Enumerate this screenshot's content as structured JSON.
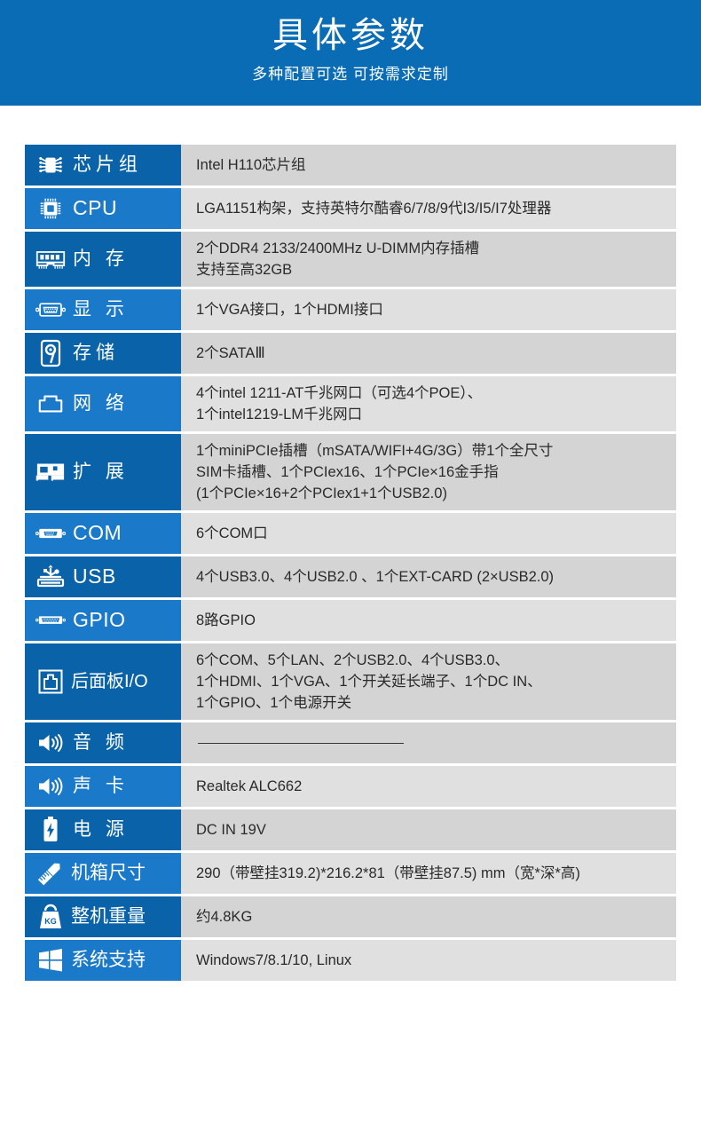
{
  "banner": {
    "title": "具体参数",
    "subtitle": "多种配置可选 可按需求定制",
    "background_color": "#0a6cb4"
  },
  "colors": {
    "label_dark": "#0a63a8",
    "label_light": "#1a7ac9",
    "value_dark": "#d4d4d4",
    "value_light": "#e0e0e0",
    "value_text": "#2a2a2a"
  },
  "spec_rows": [
    {
      "label": "芯片组",
      "icon": "chipset-icon",
      "shade": "dark",
      "lines": [
        "Intel H110芯片组"
      ]
    },
    {
      "label": "CPU",
      "icon": "cpu-icon",
      "shade": "light",
      "lines": [
        "LGA1151构架，支持英特尔酷睿6/7/8/9代I3/I5/I7处理器"
      ]
    },
    {
      "label": "内 存",
      "icon": "memory-icon",
      "shade": "dark",
      "lines": [
        "2个DDR4 2133/2400MHz U-DIMM内存插槽",
        "支持至高32GB"
      ]
    },
    {
      "label": "显 示",
      "icon": "vga-display-icon",
      "shade": "light",
      "lines": [
        "1个VGA接口，1个HDMI接口"
      ]
    },
    {
      "label": "存储",
      "icon": "hard-disk-icon",
      "shade": "dark",
      "lines": [
        "2个SATAⅢ"
      ]
    },
    {
      "label": "网 络",
      "icon": "rj45-network-icon",
      "shade": "light",
      "lines": [
        "4个intel 1211-AT千兆网口（可选4个POE）、",
        "1个intel1219-LM千兆网口"
      ]
    },
    {
      "label": "扩 展",
      "icon": "expansion-card-icon",
      "shade": "dark",
      "lines": [
        "1个miniPCIe插槽（mSATA/WIFI+4G/3G）带1个全尺寸",
        "SIM卡插槽、1个PCIex16、1个PCIe×16金手指",
        "(1个PCIe×16+2个PCIex1+1个USB2.0)"
      ]
    },
    {
      "label": "COM",
      "icon": "com-port-icon",
      "shade": "light",
      "lines": [
        "6个COM口"
      ]
    },
    {
      "label": "USB",
      "icon": "usb-icon",
      "shade": "dark",
      "lines": [
        "4个USB3.0、4个USB2.0 、1个EXT-CARD (2×USB2.0)"
      ]
    },
    {
      "label": "GPIO",
      "icon": "gpio-connector-icon",
      "shade": "light",
      "lines": [
        "8路GPIO"
      ]
    },
    {
      "label": "后面板I/O",
      "icon": "rear-panel-icon",
      "shade": "dark",
      "lines": [
        "6个COM、5个LAN、2个USB2.0、4个USB3.0、",
        "1个HDMI、1个VGA、1个开关延长端子、1个DC IN、",
        "1个GPIO、1个电源开关"
      ]
    },
    {
      "label": "音 频",
      "icon": "speaker-icon",
      "shade": "dark",
      "lines": [
        ""
      ],
      "rule": true
    },
    {
      "label": "声 卡",
      "icon": "speaker-icon",
      "shade": "light",
      "lines": [
        "Realtek ALC662"
      ]
    },
    {
      "label": "电 源",
      "icon": "battery-power-icon",
      "shade": "dark",
      "lines": [
        "DC IN 19V"
      ]
    },
    {
      "label": "机箱尺寸",
      "icon": "ruler-pencil-icon",
      "shade": "light",
      "lines": [
        "290（带壁挂319.2)*216.2*81（带壁挂87.5) mm（宽*深*高)"
      ]
    },
    {
      "label": "整机重量",
      "icon": "weight-kg-icon",
      "shade": "dark",
      "lines": [
        "约4.8KG"
      ]
    },
    {
      "label": "系统支持",
      "icon": "windows-logo-icon",
      "shade": "light",
      "lines": [
        "Windows7/8.1/10, Linux"
      ]
    }
  ]
}
